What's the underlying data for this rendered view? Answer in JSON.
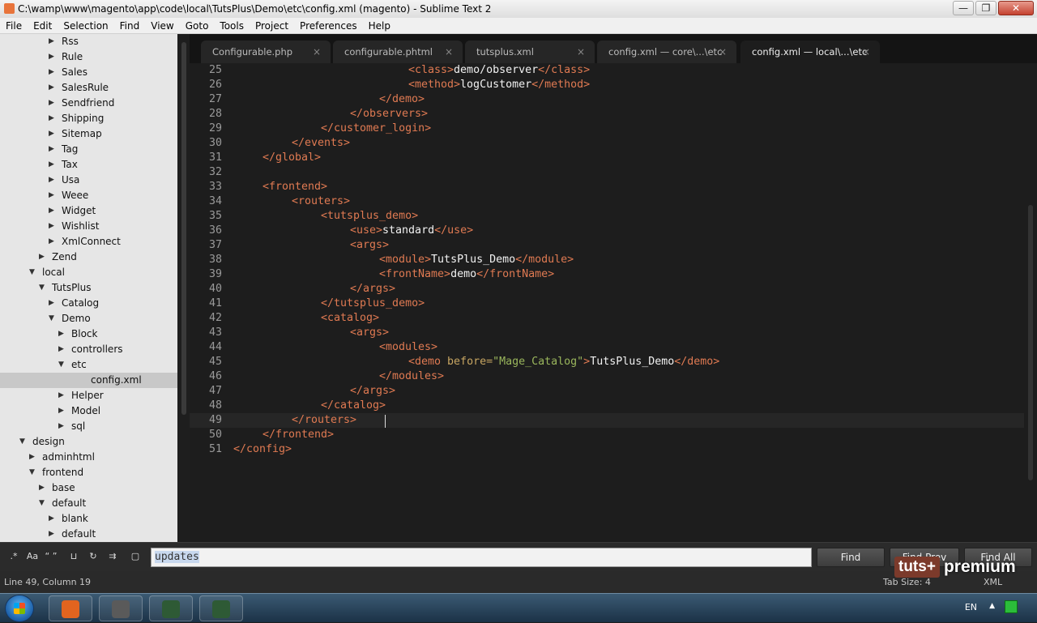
{
  "window": {
    "title": "C:\\wamp\\www\\magento\\app\\code\\local\\TutsPlus\\Demo\\etc\\config.xml (magento) - Sublime Text 2",
    "buttons": {
      "minimize": "—",
      "maximize": "❐",
      "close": "✕"
    }
  },
  "menu": [
    "File",
    "Edit",
    "Selection",
    "Find",
    "View",
    "Goto",
    "Tools",
    "Project",
    "Preferences",
    "Help"
  ],
  "sidebar": {
    "items": [
      {
        "label": "Rss",
        "depth": 3,
        "state": "closed"
      },
      {
        "label": "Rule",
        "depth": 3,
        "state": "closed"
      },
      {
        "label": "Sales",
        "depth": 3,
        "state": "closed"
      },
      {
        "label": "SalesRule",
        "depth": 3,
        "state": "closed"
      },
      {
        "label": "Sendfriend",
        "depth": 3,
        "state": "closed"
      },
      {
        "label": "Shipping",
        "depth": 3,
        "state": "closed"
      },
      {
        "label": "Sitemap",
        "depth": 3,
        "state": "closed"
      },
      {
        "label": "Tag",
        "depth": 3,
        "state": "closed"
      },
      {
        "label": "Tax",
        "depth": 3,
        "state": "closed"
      },
      {
        "label": "Usa",
        "depth": 3,
        "state": "closed"
      },
      {
        "label": "Weee",
        "depth": 3,
        "state": "closed"
      },
      {
        "label": "Widget",
        "depth": 3,
        "state": "closed"
      },
      {
        "label": "Wishlist",
        "depth": 3,
        "state": "closed"
      },
      {
        "label": "XmlConnect",
        "depth": 3,
        "state": "closed"
      },
      {
        "label": "Zend",
        "depth": 2,
        "state": "closed"
      },
      {
        "label": "local",
        "depth": 1,
        "state": "open"
      },
      {
        "label": "TutsPlus",
        "depth": 2,
        "state": "open"
      },
      {
        "label": "Catalog",
        "depth": 3,
        "state": "closed"
      },
      {
        "label": "Demo",
        "depth": 3,
        "state": "open"
      },
      {
        "label": "Block",
        "depth": 4,
        "state": "closed"
      },
      {
        "label": "controllers",
        "depth": 4,
        "state": "closed"
      },
      {
        "label": "etc",
        "depth": 4,
        "state": "open"
      },
      {
        "label": "config.xml",
        "depth": 5,
        "state": "file",
        "selected": true
      },
      {
        "label": "Helper",
        "depth": 4,
        "state": "closed"
      },
      {
        "label": "Model",
        "depth": 4,
        "state": "closed"
      },
      {
        "label": "sql",
        "depth": 4,
        "state": "closed"
      },
      {
        "label": "design",
        "depth": 0,
        "state": "open"
      },
      {
        "label": "adminhtml",
        "depth": 1,
        "state": "closed"
      },
      {
        "label": "frontend",
        "depth": 1,
        "state": "open"
      },
      {
        "label": "base",
        "depth": 2,
        "state": "closed"
      },
      {
        "label": "default",
        "depth": 2,
        "state": "open"
      },
      {
        "label": "blank",
        "depth": 3,
        "state": "closed"
      },
      {
        "label": "default",
        "depth": 3,
        "state": "closed"
      }
    ]
  },
  "tabs": [
    {
      "label": "Configurable.php",
      "active": false
    },
    {
      "label": "configurable.phtml",
      "active": false
    },
    {
      "label": "tutsplus.xml",
      "active": false
    },
    {
      "label": "config.xml — core\\...\\etc",
      "active": false
    },
    {
      "label": "config.xml — local\\...\\etc",
      "active": true
    }
  ],
  "tab_close": "×",
  "editor": {
    "current_line": 49,
    "lines": [
      {
        "n": "25",
        "i": 6,
        "p": [
          [
            "tg",
            "<class>"
          ],
          [
            "tx",
            "demo/observer"
          ],
          [
            "tg",
            "</class>"
          ]
        ]
      },
      {
        "n": "26",
        "i": 6,
        "p": [
          [
            "tg",
            "<method>"
          ],
          [
            "tx",
            "logCustomer"
          ],
          [
            "tg",
            "</method>"
          ]
        ]
      },
      {
        "n": "27",
        "i": 5,
        "p": [
          [
            "tg",
            "</demo>"
          ]
        ]
      },
      {
        "n": "28",
        "i": 4,
        "p": [
          [
            "tg",
            "</observers>"
          ]
        ]
      },
      {
        "n": "29",
        "i": 3,
        "p": [
          [
            "tg",
            "</customer_login>"
          ]
        ]
      },
      {
        "n": "30",
        "i": 2,
        "p": [
          [
            "tg",
            "</events>"
          ]
        ]
      },
      {
        "n": "31",
        "i": 1,
        "p": [
          [
            "tg",
            "</global>"
          ]
        ]
      },
      {
        "n": "32",
        "i": 0,
        "p": []
      },
      {
        "n": "33",
        "i": 1,
        "p": [
          [
            "tg",
            "<frontend>"
          ]
        ]
      },
      {
        "n": "34",
        "i": 2,
        "p": [
          [
            "tg",
            "<routers>"
          ]
        ]
      },
      {
        "n": "35",
        "i": 3,
        "p": [
          [
            "tg",
            "<tutsplus_demo>"
          ]
        ]
      },
      {
        "n": "36",
        "i": 4,
        "p": [
          [
            "tg",
            "<use>"
          ],
          [
            "tx",
            "standard"
          ],
          [
            "tg",
            "</use>"
          ]
        ]
      },
      {
        "n": "37",
        "i": 4,
        "p": [
          [
            "tg",
            "<args>"
          ]
        ]
      },
      {
        "n": "38",
        "i": 5,
        "p": [
          [
            "tg",
            "<module>"
          ],
          [
            "tx",
            "TutsPlus_Demo"
          ],
          [
            "tg",
            "</module>"
          ]
        ]
      },
      {
        "n": "39",
        "i": 5,
        "p": [
          [
            "tg",
            "<frontName>"
          ],
          [
            "tx",
            "demo"
          ],
          [
            "tg",
            "</frontName>"
          ]
        ]
      },
      {
        "n": "40",
        "i": 4,
        "p": [
          [
            "tg",
            "</args>"
          ]
        ]
      },
      {
        "n": "41",
        "i": 3,
        "p": [
          [
            "tg",
            "</tutsplus_demo>"
          ]
        ]
      },
      {
        "n": "42",
        "i": 3,
        "p": [
          [
            "tg",
            "<catalog>"
          ]
        ]
      },
      {
        "n": "43",
        "i": 4,
        "p": [
          [
            "tg",
            "<args>"
          ]
        ]
      },
      {
        "n": "44",
        "i": 5,
        "p": [
          [
            "tg",
            "<modules>"
          ]
        ]
      },
      {
        "n": "45",
        "i": 6,
        "p": [
          [
            "tg",
            "<demo "
          ],
          [
            "at",
            "before="
          ],
          [
            "sv",
            "\"Mage_Catalog\""
          ],
          [
            "tg",
            ">"
          ],
          [
            "tx",
            "TutsPlus_Demo"
          ],
          [
            "tg",
            "</demo>"
          ]
        ]
      },
      {
        "n": "46",
        "i": 5,
        "p": [
          [
            "tg",
            "</modules>"
          ]
        ]
      },
      {
        "n": "47",
        "i": 4,
        "p": [
          [
            "tg",
            "</args>"
          ]
        ]
      },
      {
        "n": "48",
        "i": 3,
        "p": [
          [
            "tg",
            "</catalog>"
          ]
        ]
      },
      {
        "n": "49",
        "i": 2,
        "p": [
          [
            "tg",
            "</routers>"
          ]
        ]
      },
      {
        "n": "50",
        "i": 1,
        "p": [
          [
            "tg",
            "</frontend>"
          ]
        ]
      },
      {
        "n": "51",
        "i": 0,
        "p": [
          [
            "tg",
            "</config>"
          ]
        ]
      }
    ]
  },
  "find": {
    "options": [
      ".*",
      "Aa",
      "“ ”",
      "⊔",
      "↻",
      "⇉",
      "▢"
    ],
    "query": "updates",
    "find_label": "Find",
    "find_prev_label": "Find Prev",
    "find_all_label": "Find All"
  },
  "status": {
    "position": "Line 49, Column 19",
    "tab_size": "Tab Size: 4",
    "syntax": "XML"
  },
  "watermark": {
    "brand": "tuts+",
    "tier": "premium"
  },
  "taskbar": {
    "apps": [
      {
        "name": "firefox",
        "color": "#e2641f"
      },
      {
        "name": "sublime-text",
        "color": "#5a5a5a"
      },
      {
        "name": "cmd-terminal",
        "color": "#2e5a35"
      },
      {
        "name": "cmd-terminal-2",
        "color": "#2e5a35"
      }
    ],
    "tray_lang": "EN",
    "tray_up": "▲"
  }
}
